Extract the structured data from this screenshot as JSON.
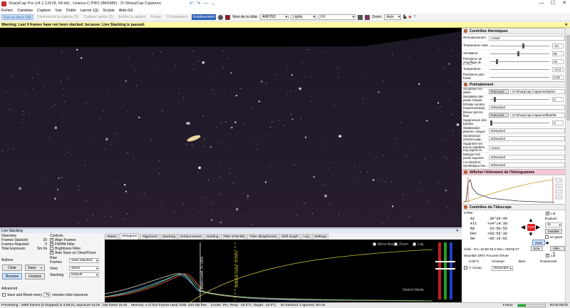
{
  "window": {
    "title": "SharpCap Pro (v4.1.13218, 64 bit) - Uranus-C PRO (IMX585) - D:\\SharpCap Captures",
    "controls": [
      "—",
      "☐",
      "✕"
    ]
  },
  "menu": [
    "Fichier",
    "Caméras",
    "Capture",
    "Vue",
    "Outils",
    "Lancer (Q)",
    "Scripts",
    "Aide (H)"
  ],
  "toolbar": {
    "live_label": "Vue en direct (W)",
    "start_capture": "Commencer la capture (S)",
    "quick_capture": "Capture rapide (Q)",
    "stop_capture": "Arrêter la capture",
    "pause": "Pause",
    "snapshot": "Vû Instantané",
    "placement": "Emplacement",
    "target_label": "Nom de la cible:",
    "target_value": "ARP293",
    "lights_value": "Lights",
    "fx_label": "FX",
    "zoom_label": "Zoom:",
    "zoom_value": "Auto"
  },
  "warning": {
    "text": "Warning: Last 9 frames have not been stacked. because: Live Stacking is paused.",
    "close": "✕"
  },
  "sidebar": {
    "thermal": {
      "title": "Contrôles thermiques",
      "rows": [
        {
          "label": "Refroidissement",
          "value": "Activé"
        },
        {
          "label": "Température cible",
          "num": "-10"
        },
        {
          "label": "Ventilateur",
          "num": "50"
        },
        {
          "label": "Puissance de chauffage de fenêtre",
          "num": "10"
        },
        {
          "label": "Température",
          "num": "-10.0"
        },
        {
          "label": "Puissance plus froide",
          "num": "0.00"
        }
      ]
    },
    "preprocess": {
      "title": "Prétraitement",
      "dark_label": "Soustraire les darks",
      "dark_btn": "Parcourir...",
      "dark_path": "D:\\SharpCap Captures\\darks\\",
      "hot_label": "Sensibilité des pixels chauds",
      "hot_value": "5",
      "dark_scale_label": "Échelle sombre (expérimentale)",
      "dark_scale_value": "Désactivé",
      "flat_label": "Diviser par les flats",
      "flat_btn": "Parcourir...",
      "flat_path": "D:\\SharpCap Captures\\flats\\M",
      "bands_label": "Suppression des bandes",
      "bands_value": "0",
      "stab_label": "Stabilisation planète / disque",
      "stab_value": "Désactivé",
      "bg_label": "Soustraction d'arrière-plan",
      "bg_value": "Désactivé",
      "sat_label": "Supprimer les traces satellites trop (après la tombée de la nuit)",
      "sat_value": "Aucun",
      "mask_label": "Masquer les pixels exposés",
      "mask_value": "Désactivé",
      "nr_label": "La réduction: Synthétique flou...",
      "nr_value": "Désactivé"
    },
    "histogram": {
      "title": "Afficher l'étirement de l'histogramme"
    },
    "telescope": {
      "title": "Contrôles du Télescope",
      "name": "CPWI",
      "connected_label": "Lié",
      "fields": [
        {
          "k": "Az",
          "v": "38°30:46"
        },
        {
          "k": "Alt",
          "v": "+34°14:39"
        },
        {
          "k": "RA",
          "v": "16:50:55"
        },
        {
          "k": "Déc",
          "v": "+58:55:30"
        },
        {
          "k": "AH",
          "v": "-06:16:02"
        }
      ],
      "rate_label": "Évaluer:",
      "rate_value": "4x",
      "stop_label": "STOP",
      "install_label": "Installer",
      "park_label": "se garer",
      "follow_label": "Suivi",
      "coords_label": "Cible : RA=16:50:48,3 Dec=+58:55:27",
      "goto_btn": "Erre",
      "goto2_btn": "Aller à",
      "focuser_title": "Moonlite DRO Focuser Driver",
      "focuser_temp": "0.00°C",
      "focuser_coarse": "Grossier",
      "focuser_good": "Bien",
      "focuser_position": "Positionner",
      "focuser_linked": "Lié",
      "focuser_t_label": "T. Comp",
      "focuser_mode": "Désactivé"
    }
  },
  "live_stacking": {
    "title": "Live Stacking",
    "overview_title": "Overview",
    "overview": [
      {
        "k": "Frames Stacked:",
        "v": "20"
      },
      {
        "k": "Frames Rejected:",
        "v": "0"
      },
      {
        "k": "Total Exposure:",
        "v": "5m 0s"
      }
    ],
    "actions_title": "Actions",
    "clear": "Clear",
    "save": "Save",
    "resume": "Resume",
    "unstack": "Unstack",
    "advanced_title": "Advanced",
    "save_reset": "Save and Reset every",
    "save_reset_value": "5",
    "minutes_label": "minutes total exposure",
    "controls_title": "Controls",
    "align": "Align Frames",
    "fwhm": "FWHM Filter",
    "brightness": "Brightness Filter",
    "autosave": "Auto Save on Clear/Close",
    "raw_label": "Raw Frames",
    "raw_value": "Save Stacked",
    "view_label": "View",
    "view_value": "Stack",
    "stacking_label": "Stacking",
    "stacking_value": "Default",
    "tabs": [
      "Status",
      "Histogram",
      "Alignment",
      "Stacking",
      "Enhancement",
      "Guiding",
      "Filter (FWHM)",
      "Filter (Brightness)",
      "Drift Graph",
      "Log",
      "Settings"
    ],
    "plot": {
      "mode_label": "Mono Axis",
      "zoom_label": "Zoom",
      "log_label": "Log",
      "stretch_label": "Stretch Mode",
      "black_level": "Black Level: 47.25%",
      "midtone_level": "Midtone Level: 70.40%"
    }
  },
  "statusbar": {
    "preview": "Previewing : 4965 frames (0 dropped) in 3:09:21, exposure 15.0s , last frame 15.0s",
    "memory": "Memory: 4 of 510 frames used, Disk: 243 GB free",
    "cooler": "Cooler: 0%, Temp: -10.0°C, Target: -10.0°C",
    "stacked": "20 Stacked, 0 Ignored, 5m 0s",
    "frame_label": "Frame",
    "time": "00:05:00/10"
  },
  "colors": {
    "accent": "#2d5fb5",
    "warning_bg": "#fff9a6",
    "stop_red": "#e02020",
    "histogram_pink": "#f8c8d4"
  }
}
